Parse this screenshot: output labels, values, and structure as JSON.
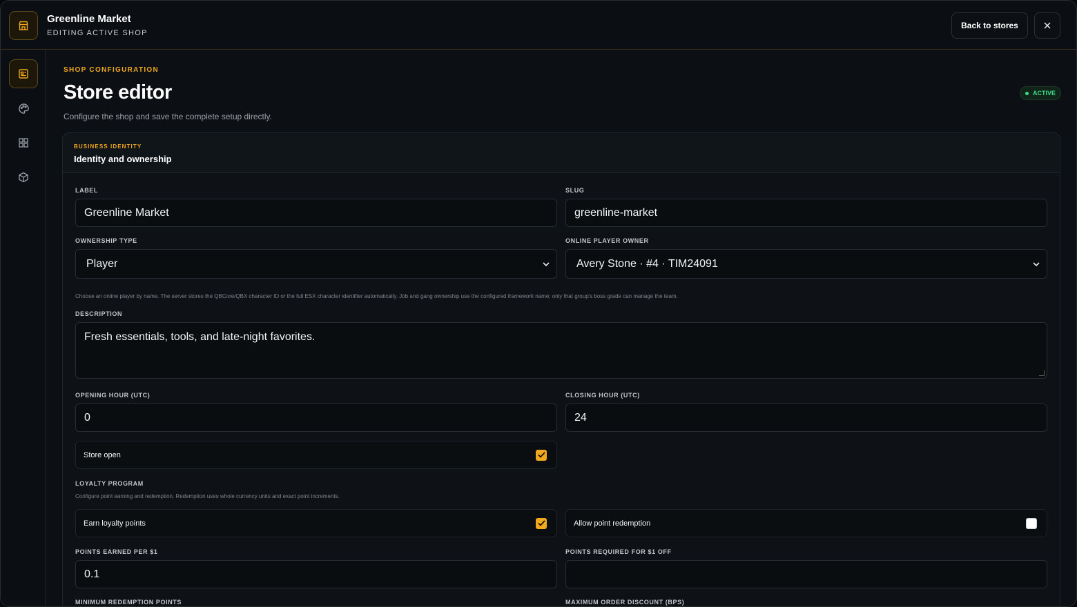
{
  "header": {
    "title": "Greenline Market",
    "subtitle": "EDITING ACTIVE SHOP",
    "back_label": "Back to stores",
    "close_icon": "close-icon",
    "brand_icon": "store-icon"
  },
  "sidebar": {
    "items": [
      {
        "icon": "store-config-icon",
        "active": true
      },
      {
        "icon": "palette-icon",
        "active": false
      },
      {
        "icon": "grid-icon",
        "active": false
      },
      {
        "icon": "package-icon",
        "active": false
      }
    ]
  },
  "page": {
    "eyebrow": "SHOP CONFIGURATION",
    "title": "Store editor",
    "description": "Configure the shop and save the complete setup directly.",
    "status_badge": "ACTIVE"
  },
  "card": {
    "eyebrow": "BUSINESS IDENTITY",
    "title": "Identity and ownership"
  },
  "form": {
    "label": {
      "label": "LABEL",
      "value": "Greenline Market"
    },
    "slug": {
      "label": "SLUG",
      "value": "greenline-market"
    },
    "ownership_type": {
      "label": "OWNERSHIP TYPE",
      "value": "Player"
    },
    "online_owner": {
      "label": "ONLINE PLAYER OWNER",
      "value": "Avery Stone · #4 · TIM24091"
    },
    "owner_help": "Choose an online player by name. The server stores the QBCore/QBX character ID or the full ESX character identifier automatically. Job and gang ownership use the configured framework name; only that group's boss grade can manage the team.",
    "description": {
      "label": "DESCRIPTION",
      "value": "Fresh essentials, tools, and late-night favorites."
    },
    "opening_hour": {
      "label": "OPENING HOUR (UTC)",
      "value": "0"
    },
    "closing_hour": {
      "label": "CLOSING HOUR (UTC)",
      "value": "24"
    },
    "store_open": {
      "label": "Store open",
      "checked": true
    },
    "loyalty": {
      "heading": "LOYALTY PROGRAM",
      "help": "Configure point earning and redemption. Redemption uses whole currency units and exact point increments.",
      "earn": {
        "label": "Earn loyalty points",
        "checked": true
      },
      "redeem": {
        "label": "Allow point redemption",
        "checked": false
      }
    },
    "points_earned": {
      "label": "POINTS EARNED PER $1",
      "value": "0.1"
    },
    "points_required": {
      "label": "POINTS REQUIRED FOR $1 OFF",
      "value": ""
    },
    "min_redemption": {
      "label": "MINIMUM REDEMPTION POINTS"
    },
    "max_discount": {
      "label": "MAXIMUM ORDER DISCOUNT (BPS)"
    }
  },
  "colors": {
    "accent": "#f0a81e",
    "success": "#3ddc84",
    "background": "#0c0f13"
  }
}
